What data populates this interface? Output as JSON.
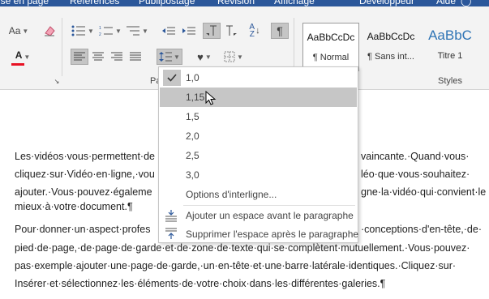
{
  "tabs": [
    "ise en page",
    "Références",
    "Publipostage",
    "Révision",
    "Affichage",
    "Développeur",
    "Aide"
  ],
  "ribbon": {
    "font_size_label": "Aa",
    "paragraph_group_label": "Pa",
    "styles_group_label": "Styles",
    "styles": [
      {
        "preview": "AaBbCcDc",
        "name": "¶ Normal"
      },
      {
        "preview": "AaBbCcDc",
        "name": "¶ Sans int..."
      },
      {
        "preview": "AaBbC",
        "name": "Titre 1"
      }
    ],
    "accent_color": "#2b579a",
    "font_color": "#e81123"
  },
  "line_spacing_menu": {
    "options": [
      "1,0",
      "1,15",
      "1,5",
      "2,0",
      "2,5",
      "3,0"
    ],
    "checked": "1,0",
    "hovered": "1,15",
    "more_options": "Options d'interligne...",
    "add_space_before": "Ajouter un espace avant le paragraphe",
    "remove_space_after": "Supprimer l'espace après le paragraphe"
  },
  "document": {
    "paragraph1": [
      "Les·vidéos·vous·permettent·de",
      "vaincante.·Quand·vous·",
      "cliquez·sur·Vidéo·en·ligne,·vou",
      "léo·que·vous·souhaitez·",
      "ajouter.·Vous·pouvez·égaleme",
      "gne·la·vidéo·qui·convient·le",
      "mieux·à·votre·document.¶"
    ],
    "paragraph2": [
      "Pour·donner·un·aspect·profes",
      "·conceptions·d'en-tête,·de·",
      "pied·de·page,·de·page·de·garde·et·de·zone·de·texte·qui·se·complètent·mutuellement.·Vous·pouvez·",
      "pas·exemple·ajouter·une·page·de·garde,·un·en-tête·et·une·barre·latérale·identiques.·Cliquez·sur·",
      "Insérer·et·sélectionnez·les·éléments·de·votre·choix·dans·les·différentes·galeries.¶"
    ]
  }
}
